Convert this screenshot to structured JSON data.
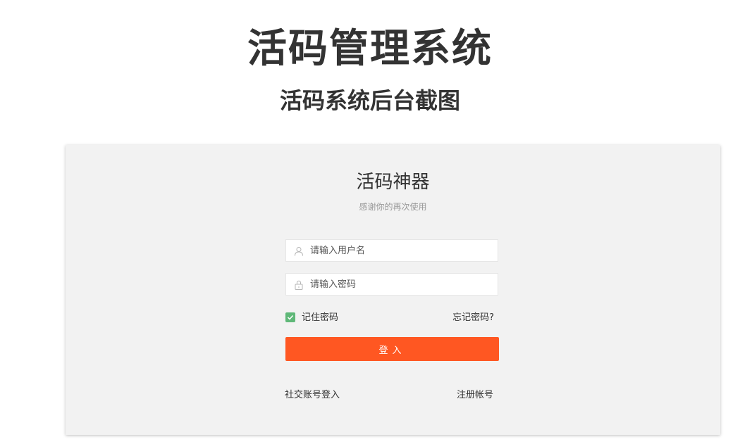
{
  "header": {
    "title": "活码管理系统",
    "subtitle": "活码系统后台截图"
  },
  "login": {
    "app_title": "活码神器",
    "app_subtitle": "感谢你的再次使用",
    "username_placeholder": "请输入用户名",
    "password_placeholder": "请输入密码",
    "remember_label": "记住密码",
    "remember_checked": true,
    "forgot_label": "忘记密码?",
    "submit_label": "登入",
    "social_login_label": "社交账号登入",
    "register_label": "注册帐号"
  },
  "colors": {
    "primary_button": "#ff5722",
    "checkbox": "#5fb878",
    "panel_background": "#f2f2f2"
  },
  "icons": {
    "username": "user-icon",
    "password": "lock-icon",
    "checkbox": "check-icon"
  }
}
